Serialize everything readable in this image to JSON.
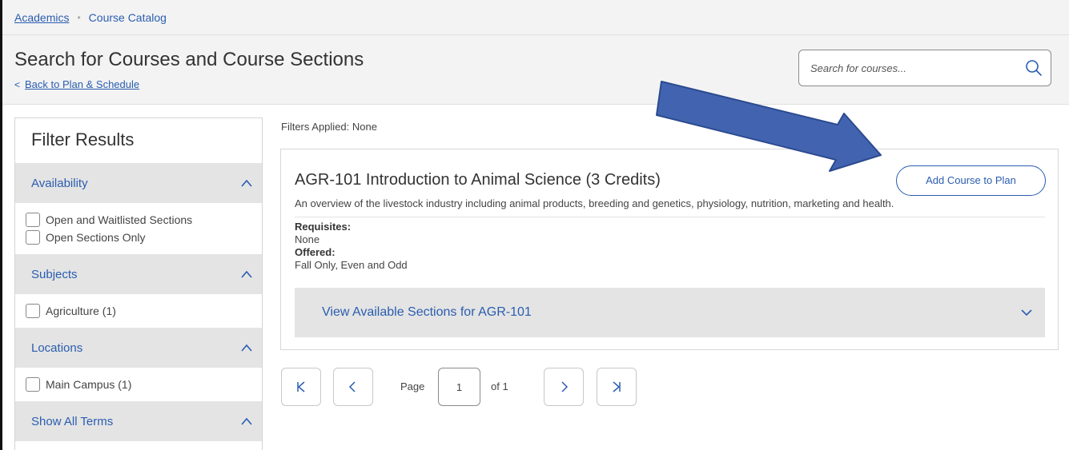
{
  "breadcrumb": {
    "parent": "Academics",
    "separator": "•",
    "current": "Course Catalog"
  },
  "header": {
    "title": "Search for Courses and Course Sections",
    "back_chevron": "<",
    "back_label": "Back to Plan & Schedule",
    "search_placeholder": "Search for courses..."
  },
  "filters": {
    "title": "Filter Results",
    "groups": [
      {
        "label": "Availability",
        "options": [
          "Open and Waitlisted Sections",
          "Open Sections Only"
        ]
      },
      {
        "label": "Subjects",
        "options": [
          "Agriculture (1)"
        ]
      },
      {
        "label": "Locations",
        "options": [
          "Main Campus (1)"
        ]
      },
      {
        "label": "Show All Terms",
        "options": []
      }
    ]
  },
  "results": {
    "filters_applied": "Filters Applied: None",
    "course": {
      "title": "AGR-101 Introduction to Animal Science (3 Credits)",
      "description": "An overview of the livestock industry including animal products, breeding and genetics, physiology, nutrition, marketing and health.",
      "add_button": "Add Course to Plan",
      "requisites_label": "Requisites:",
      "requisites_value": "None",
      "offered_label": "Offered:",
      "offered_value": "Fall Only, Even and Odd",
      "sections_label": "View Available Sections for AGR-101"
    }
  },
  "pagination": {
    "page_label": "Page",
    "current_page": "1",
    "of_label": "of 1"
  },
  "icons": {
    "search": "search-icon",
    "caret_up": "chevron-up-icon",
    "caret_down": "chevron-down-icon",
    "first": "first-page-icon",
    "prev": "previous-page-icon",
    "next": "next-page-icon",
    "last": "last-page-icon"
  },
  "colors": {
    "accent": "#2a5db0",
    "panel_gray": "#e4e4e4",
    "header_bg": "#f3f3f3",
    "annotation_arrow": "#4264b0"
  }
}
